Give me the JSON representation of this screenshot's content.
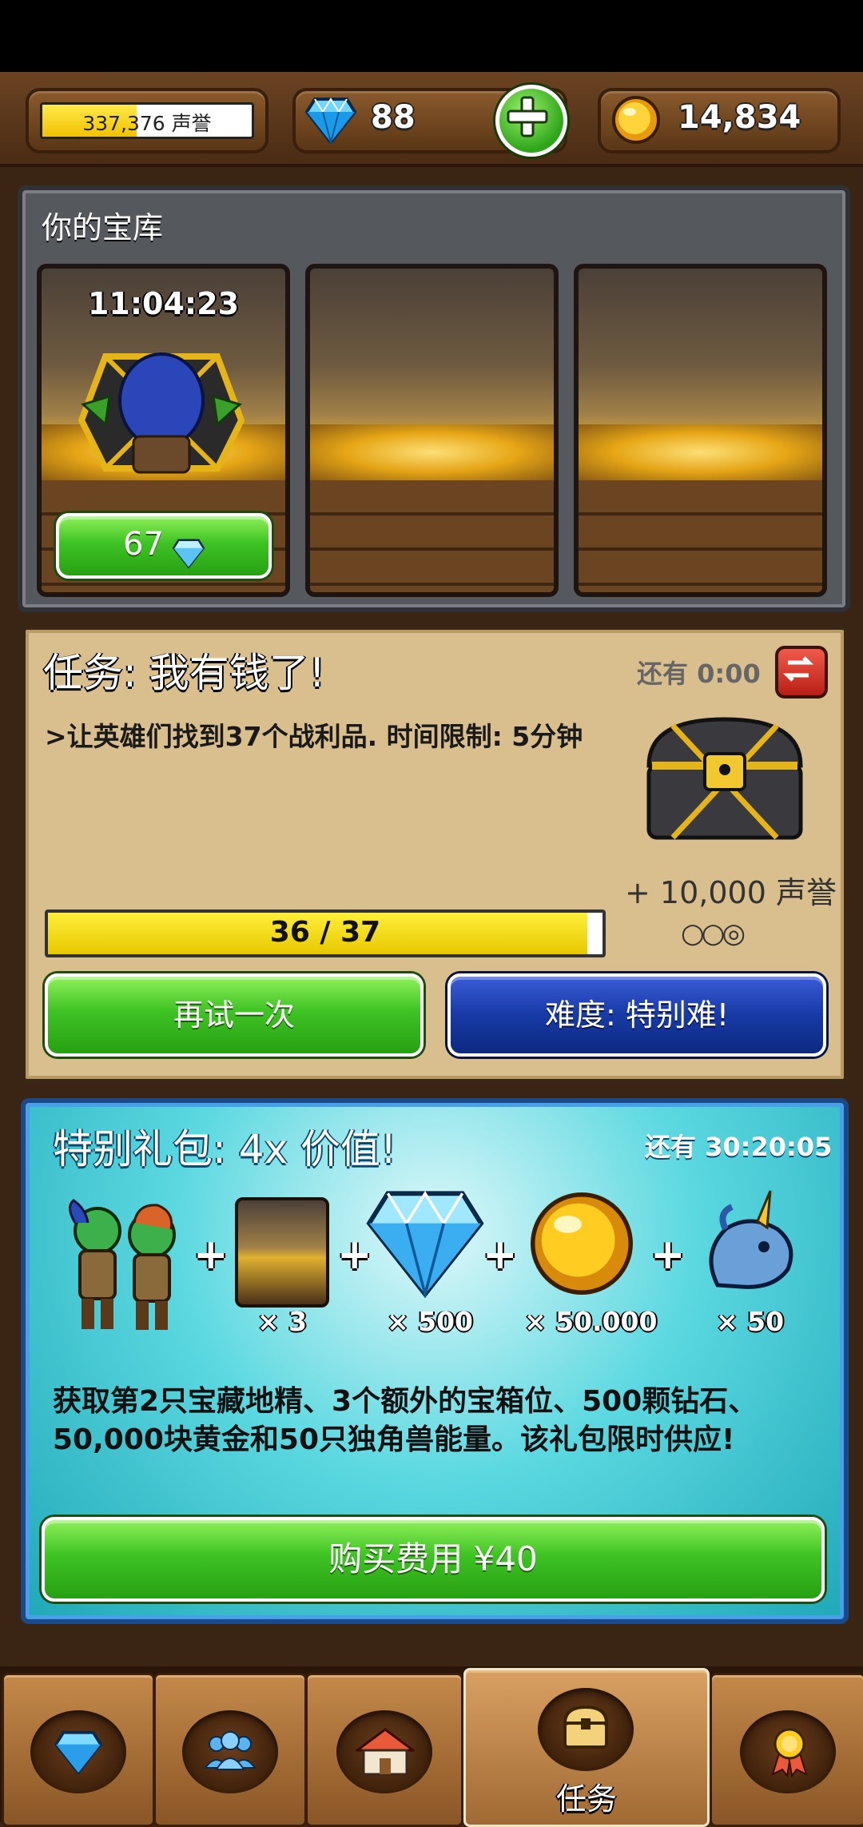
{
  "topbar": {
    "fame_text": "337,376 声誉",
    "fame_progress": 0.45,
    "gems": "88",
    "gold": "14,834"
  },
  "vault": {
    "title": "你的宝库",
    "slots": [
      {
        "timer": "11:04:23",
        "cost": "67"
      },
      {},
      {}
    ]
  },
  "mission": {
    "title": "任务: 我有钱了!",
    "timer": "还有 0:00",
    "description": ">让英雄们找到37个战利品. 时间限制: 5分钟",
    "progress_text": "36 / 37",
    "progress": 0.972,
    "reward": "+ 10,000 声誉",
    "difficulty_marks": "○○◎",
    "retry_label": "再试一次",
    "difficulty_label": "难度: 特别难!"
  },
  "offer": {
    "title": "特别礼包:  4x 价值!",
    "timer": "还有 30:20:05",
    "items": [
      {
        "icon": "goblin-pair-icon",
        "qty": ""
      },
      {
        "icon": "vault-slot-icon",
        "qty": "× 3"
      },
      {
        "icon": "diamond-icon",
        "qty": "× 500"
      },
      {
        "icon": "gold-coin-icon",
        "qty": "× 50.000"
      },
      {
        "icon": "unicorn-icon",
        "qty": "× 50"
      }
    ],
    "description": "获取第2只宝藏地精、3个额外的宝箱位、500颗钻石、50,000块黄金和50只独角兽能量。该礼包限时供应!",
    "buy_label": "购买费用 ¥40"
  },
  "nav": {
    "tabs": [
      {
        "icon": "gem-icon"
      },
      {
        "icon": "heroes-icon"
      },
      {
        "icon": "castle-icon"
      },
      {
        "icon": "treasure-chest-icon",
        "label": "任务"
      },
      {
        "icon": "medal-icon"
      }
    ]
  },
  "colors": {
    "green_button": "#3fc324",
    "blue_button": "#173aa6",
    "fame_fill": "#ffe94a",
    "offer_bg": "#5bd8e0"
  }
}
